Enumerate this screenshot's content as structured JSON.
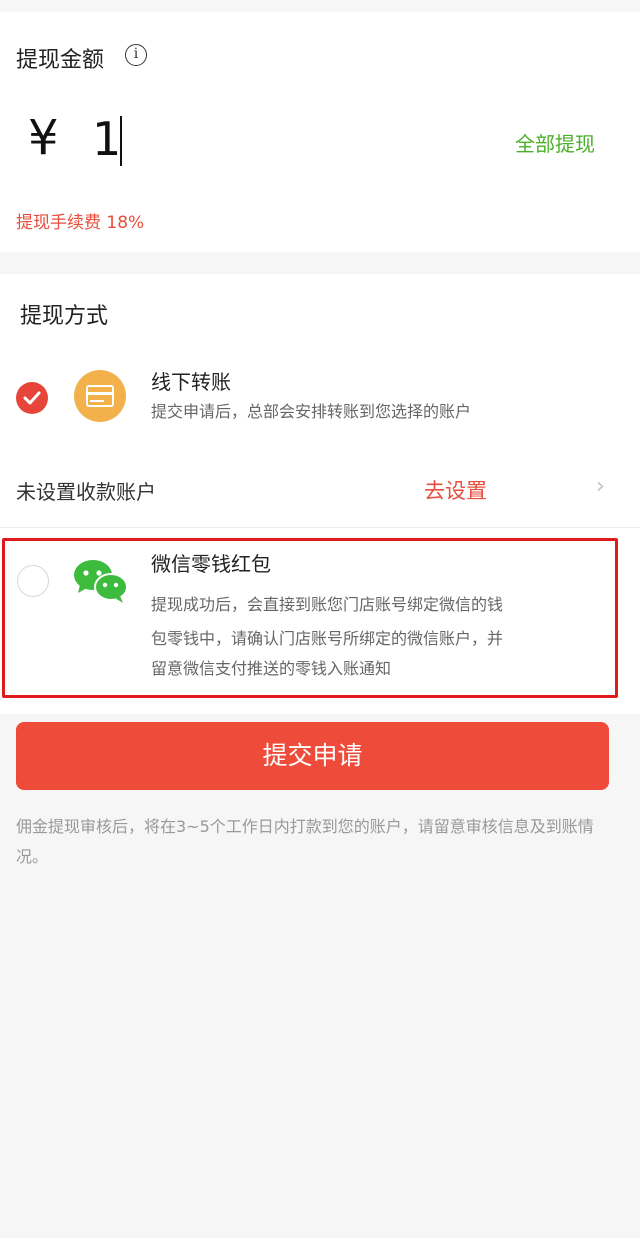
{
  "amount_section": {
    "title": "提现金额",
    "info_icon": "info-circle-icon",
    "currency_symbol": "¥",
    "amount_value": "1",
    "withdraw_all_label": "全部提现",
    "fee_text": "提现手续费 18%"
  },
  "method_section": {
    "title": "提现方式",
    "methods": [
      {
        "name": "线下转账",
        "description": "提交申请后，总部会安排转账到您选择的账户",
        "icon": "bank-card-icon",
        "selected": true
      },
      {
        "name": "微信零钱红包",
        "description_lines": [
          "提现成功后，会直接到账您门店账号绑定微信的钱",
          "包零钱中，请确认门店账号所绑定的微信账户，并",
          "留意微信支付推送的零钱入账通知"
        ],
        "icon": "wechat-icon",
        "selected": false
      }
    ],
    "account_row": {
      "label": "未设置收款账户",
      "action": "去设置",
      "chevron": "›"
    }
  },
  "submit": {
    "label": "提交申请"
  },
  "notice": "佣金提现审核后，将在3~5个工作日内打款到您的账户，请留意审核信息及到账情况。",
  "colors": {
    "accent_red": "#ef4b3a",
    "accent_green": "#4caf2a",
    "card_icon": "#f2b14b",
    "highlight_frame": "#e01b1b"
  }
}
